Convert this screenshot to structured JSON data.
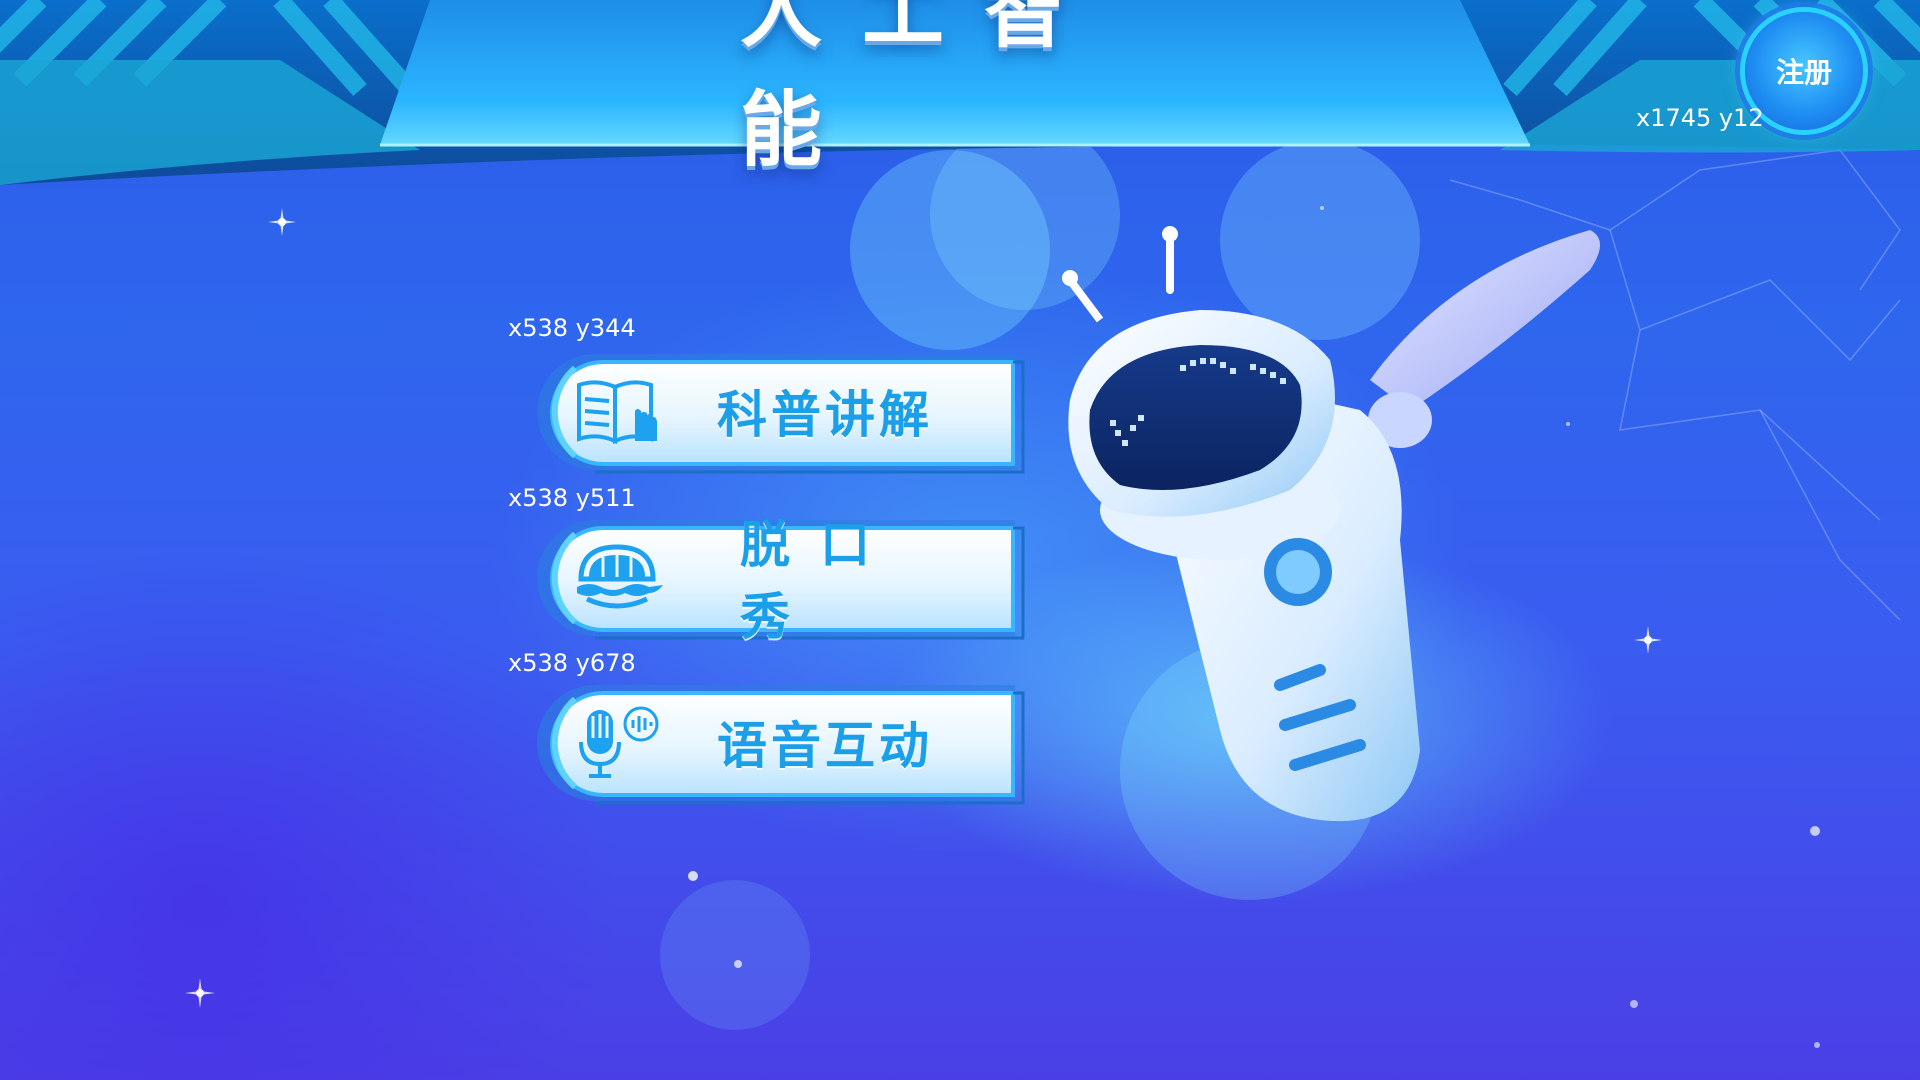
{
  "header": {
    "title": "人工智能"
  },
  "register": {
    "label": "注册",
    "coord_text": "x1745  y12"
  },
  "menu": [
    {
      "label": "科普讲解",
      "coord_text": "x538  y344",
      "icon": "book-hand-icon"
    },
    {
      "label": "脱口秀",
      "coord_text": "x538  y511",
      "icon": "mouth-icon"
    },
    {
      "label": "语音互动",
      "coord_text": "x538  y678",
      "icon": "microphone-icon"
    }
  ],
  "colors": {
    "accent": "#1b9fe8",
    "background_top": "#2a5be8",
    "background_bottom": "#4a3fe6",
    "header": "#1e8fe8"
  }
}
